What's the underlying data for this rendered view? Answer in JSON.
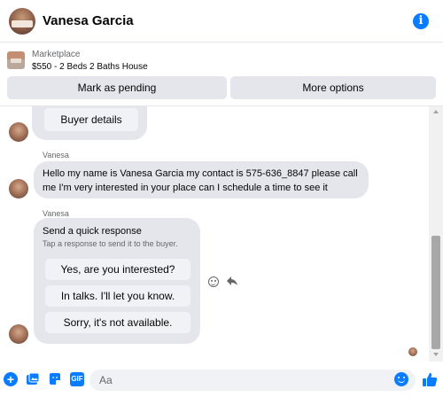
{
  "header": {
    "title": "Vanesa Garcia",
    "avatar_icon": "profile-photo",
    "info_icon": "info-icon"
  },
  "listing": {
    "category": "Marketplace",
    "title": "$550 - 2 Beds 2 Baths House",
    "pending_label": "Mark as pending",
    "more_label": "More options"
  },
  "chat": {
    "buyer_details_label": "Buyer details",
    "messages": [
      {
        "sender": "Vanesa",
        "text": "Hello my name is Vanesa Garcia my contact is 575-636_8847 please call me I'm very interested in your place can I schedule a time to see it"
      }
    ],
    "quick_response": {
      "sender": "Vanesa",
      "title": "Send a quick response",
      "subtitle": "Tap a response to send it to the buyer.",
      "options": [
        "Yes, are you interested?",
        "In talks. I'll let you know.",
        "Sorry, it's not available."
      ]
    }
  },
  "composer": {
    "placeholder": "Aa",
    "gif_label": "GIF"
  },
  "colors": {
    "accent": "#0a7cff",
    "bubble": "#e4e6eb",
    "button": "#f0f2f5"
  }
}
